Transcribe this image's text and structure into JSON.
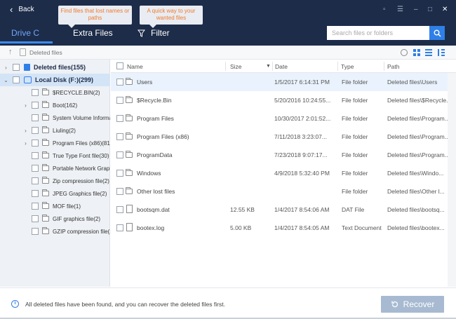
{
  "header": {
    "back_label": "Back",
    "tip_1": "Find files that lost names or paths",
    "tip_2": "A quick way to your wanted files",
    "tabs": [
      {
        "label": "Drive C"
      },
      {
        "label": "Extra Files"
      },
      {
        "label": "Filter"
      }
    ],
    "search": {
      "placeholder": "Search files or folders"
    }
  },
  "toolbar": {
    "path": "Deleted files"
  },
  "tree": {
    "items": [
      {
        "label": "Deleted files(155)"
      },
      {
        "label": "Local Disk (F:)(299)"
      },
      {
        "label": "$RECYCLE.BIN(2)"
      },
      {
        "label": "Boot(162)"
      },
      {
        "label": "System Volume Informa"
      },
      {
        "label": "Liuling(2)"
      },
      {
        "label": "Program Files (x86)(81"
      },
      {
        "label": "True Type Font file(30)"
      },
      {
        "label": "Portable Network Graph"
      },
      {
        "label": "Zip compression file(2)"
      },
      {
        "label": "JPEG Graphics file(2)"
      },
      {
        "label": "MOF file(1)"
      },
      {
        "label": "GIF graphics file(2)"
      },
      {
        "label": "GZIP compression file(2"
      }
    ]
  },
  "table": {
    "columns": {
      "name": "Name",
      "size": "Size",
      "date": "Date",
      "type": "Type",
      "path": "Path"
    },
    "rows": [
      {
        "name": "Users",
        "size": "",
        "date": "1/5/2017 6:14:31 PM",
        "type": "File folder",
        "path": "Deleted files\\Users"
      },
      {
        "name": "$Recycle.Bin",
        "size": "",
        "date": "5/20/2016 10:24:55...",
        "type": "File folder",
        "path": "Deleted files\\$Recycle..."
      },
      {
        "name": "Program Files",
        "size": "",
        "date": "10/30/2017 2:01:52...",
        "type": "File folder",
        "path": "Deleted files\\Program..."
      },
      {
        "name": "Program Files (x86)",
        "size": "",
        "date": "7/11/2018 3:23:07...",
        "type": "File folder",
        "path": "Deleted files\\Program..."
      },
      {
        "name": "ProgramData",
        "size": "",
        "date": "7/23/2018 9:07:17...",
        "type": "File folder",
        "path": "Deleted files\\Program..."
      },
      {
        "name": "Windows",
        "size": "",
        "date": "4/9/2018 5:32:40 PM",
        "type": "File folder",
        "path": "Deleted files\\Windo..."
      },
      {
        "name": "Other lost files",
        "size": "",
        "date": "",
        "type": "File folder",
        "path": "Deleted files\\Other l..."
      },
      {
        "name": "bootsqm.dat",
        "size": "12.55 KB",
        "date": "1/4/2017 8:54:06 AM",
        "type": "DAT File",
        "path": "Deleted files\\bootsq..."
      },
      {
        "name": "bootex.log",
        "size": "5.00 KB",
        "date": "1/4/2017 8:54:05 AM",
        "type": "Text Document",
        "path": "Deleted files\\bootex..."
      }
    ]
  },
  "status": {
    "message": "All deleted files have been found, and you can recover the deleted files first.",
    "recover_label": "Recover"
  }
}
